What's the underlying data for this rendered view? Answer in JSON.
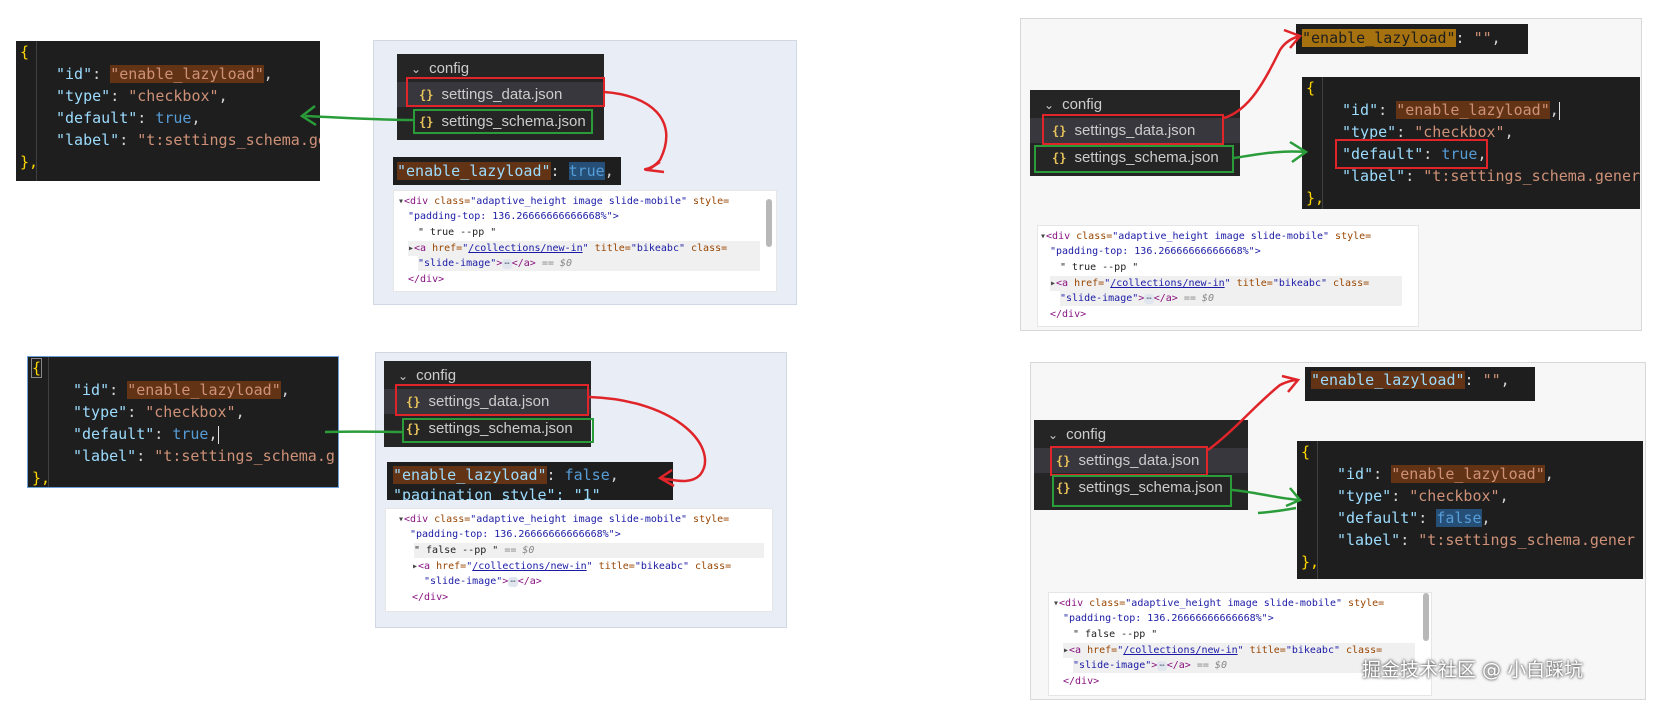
{
  "explorer": {
    "folder": "config",
    "file_data": "settings_data.json",
    "file_schema": "settings_schema.json",
    "file_icon": "json-braces-icon"
  },
  "code": {
    "open_brace": "{",
    "close_brace": "},",
    "keys": {
      "id": "\"id\"",
      "type": "\"type\"",
      "default": "\"default\"",
      "label": "\"label\""
    },
    "colon": ": ",
    "comma": ",",
    "id_open_quote": "\"",
    "id_value": "enable_lazyload",
    "id_close_quote": "\"",
    "type_value": "\"checkbox\"",
    "default_true": "true",
    "default_false": "false",
    "label_value": "\"t:settings_schema.gen",
    "label_value_b": "\"t:settings_schema.g",
    "label_value_c": "\"t:settings_schema.gener"
  },
  "data_snippet": {
    "key": "\"enable_lazyload\"",
    "key_open_quote": "\"",
    "key_text": "enable_lazyload",
    "key_close_quote": "\"",
    "value_true": "true",
    "value_false": "false",
    "value_empty": "\"\"",
    "next_key": "\"pagination_style\": \"1\"",
    "trailing": ","
  },
  "devtools": {
    "line1_tag_open": "<div",
    "line1_attr1": " class=",
    "line1_val1": "\"adaptive_height image slide-mobile\"",
    "line1_attr2": " style=",
    "line2_val": "\"padding-top: 136.26666666666668%\">",
    "text_true": "\" true --pp \"",
    "text_false": "\" false --pp \"",
    "eq_dollar": "== $0",
    "a_tag_open": "<a",
    "a_attr_href": " href=",
    "a_href_q1": "\"",
    "a_href_val": "/collections/new-in",
    "a_href_q2": "\"",
    "a_attr_title": " title=",
    "a_title_val": "\"bikeabc\"",
    "a_attr_class": " class=",
    "a_class_val": "\"slide-image\"",
    "a_gt": ">",
    "ellipsis": "⋯",
    "a_close": "</a>",
    "div_close": "</div>"
  },
  "watermark": "掘金技术社区 @ 小白踩坑",
  "colors": {
    "annotation_red": "#e0252a",
    "annotation_green": "#2a9c3a",
    "editor_bg": "#1e1e1e",
    "explorer_bg": "#252526"
  }
}
